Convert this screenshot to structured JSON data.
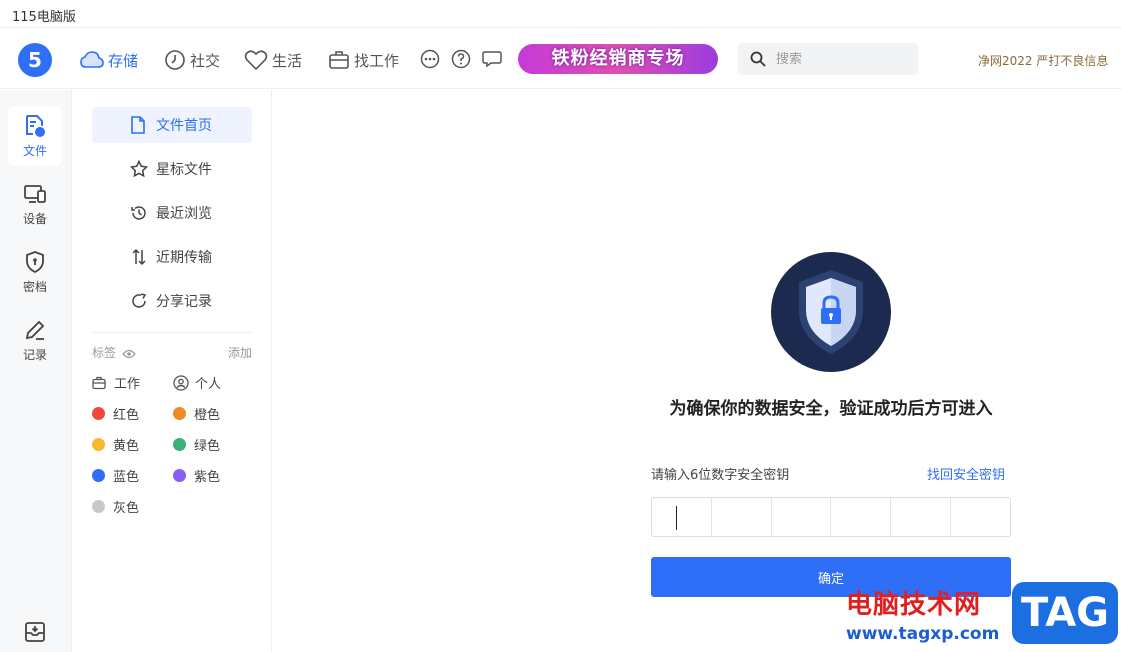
{
  "window": {
    "title": "115电脑版"
  },
  "topnav": {
    "items": [
      {
        "label": "存储",
        "icon": "cloud-icon",
        "active": true
      },
      {
        "label": "社交",
        "icon": "clock-icon"
      },
      {
        "label": "生活",
        "icon": "heart-icon"
      },
      {
        "label": "找工作",
        "icon": "briefcase-icon"
      }
    ],
    "banner": "铁粉经销商专场",
    "search_placeholder": "搜索",
    "notice": "净网2022 严打不良信息"
  },
  "rail": {
    "items": [
      {
        "label": "文件",
        "icon": "files-icon",
        "active": true
      },
      {
        "label": "设备",
        "icon": "devices-icon"
      },
      {
        "label": "密档",
        "icon": "shield-icon"
      },
      {
        "label": "记录",
        "icon": "pencil-icon"
      }
    ]
  },
  "sidebar": {
    "items": [
      {
        "label": "文件首页",
        "icon": "file-icon",
        "active": true
      },
      {
        "label": "星标文件",
        "icon": "star-icon"
      },
      {
        "label": "最近浏览",
        "icon": "history-icon"
      },
      {
        "label": "近期传输",
        "icon": "transfer-icon"
      },
      {
        "label": "分享记录",
        "icon": "share-icon"
      }
    ],
    "tags_label": "标签",
    "add_label": "添加",
    "tags": [
      {
        "label": "工作",
        "icon": "briefcase-icon"
      },
      {
        "label": "个人",
        "icon": "person-icon"
      },
      {
        "label": "红色",
        "color": "#f0483a"
      },
      {
        "label": "橙色",
        "color": "#f08a24"
      },
      {
        "label": "黄色",
        "color": "#f7b731"
      },
      {
        "label": "绿色",
        "color": "#3bb273"
      },
      {
        "label": "蓝色",
        "color": "#2f6ef6"
      },
      {
        "label": "紫色",
        "color": "#8b5cf6"
      },
      {
        "label": "灰色",
        "color": "#c8c8c8"
      }
    ]
  },
  "main": {
    "headline": "为确保你的数据安全，验证成功后方可进入",
    "pw_label": "请输入6位数字安全密钥",
    "forgot_label": "找回安全密钥",
    "confirm_label": "确定"
  },
  "watermark": {
    "cn": "电脑技术网",
    "url": "www.tagxp.com",
    "tag": "TAG"
  }
}
